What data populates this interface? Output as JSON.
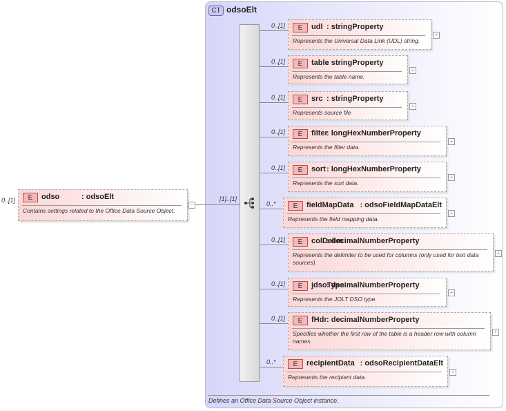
{
  "root": {
    "cardinality": "0..[1]",
    "badge": "E",
    "name": "odso",
    "type": ": odsoElt",
    "description": "Contains settings related to the Office Data Source Object.",
    "toggle": "−"
  },
  "complex_type": {
    "badge": "CT",
    "name": "odsoElt",
    "sequence_cardinality": "[1]..[1]",
    "footer": "Defines an Office Data Source Object instance."
  },
  "elements": [
    {
      "cardinality": "0..[1]",
      "badge": "E",
      "name": "udl",
      "type": ": stringProperty",
      "description": "Represents the Universal Data Link (UDL) string.",
      "toggle": "+"
    },
    {
      "cardinality": "0..[1]",
      "badge": "E",
      "name": "table",
      "type": ": stringProperty",
      "description": "Represents the table name.",
      "toggle": "+"
    },
    {
      "cardinality": "0..[1]",
      "badge": "E",
      "name": "src",
      "type": ": stringProperty",
      "description": "Represents source file",
      "toggle": "+"
    },
    {
      "cardinality": "0..[1]",
      "badge": "E",
      "name": "filter",
      "type": ": longHexNumberProperty",
      "description": "Represents the filter data.",
      "toggle": "+"
    },
    {
      "cardinality": "0..[1]",
      "badge": "E",
      "name": "sort",
      "type": ": longHexNumberProperty",
      "description": "Represents the sort data.",
      "toggle": "+"
    },
    {
      "cardinality": "0..*",
      "badge": "E",
      "name": "fieldMapData",
      "type": ": odsoFieldMapDataElt",
      "description": "Represents the field mapping data.",
      "toggle": "+"
    },
    {
      "cardinality": "0..[1]",
      "badge": "E",
      "name": "colDelim",
      "type": ": decimalNumberProperty",
      "description": "Represents the delimiter to be used for columns (only used for text data sources).",
      "toggle": "+"
    },
    {
      "cardinality": "0..[1]",
      "badge": "E",
      "name": "jdsoType",
      "type": ": decimalNumberProperty",
      "description": "Represents the JOLT DSO type.",
      "toggle": "+"
    },
    {
      "cardinality": "0..[1]",
      "badge": "E",
      "name": "fHdr",
      "type": ": decimalNumberProperty",
      "description": "Specifies whether the first row of the table is a header row with column names.",
      "toggle": "+"
    },
    {
      "cardinality": "0..*",
      "badge": "E",
      "name": "recipientData",
      "type": ": odsoRecipientDataElt",
      "description": "Represents the recipient data.",
      "toggle": "+"
    }
  ]
}
